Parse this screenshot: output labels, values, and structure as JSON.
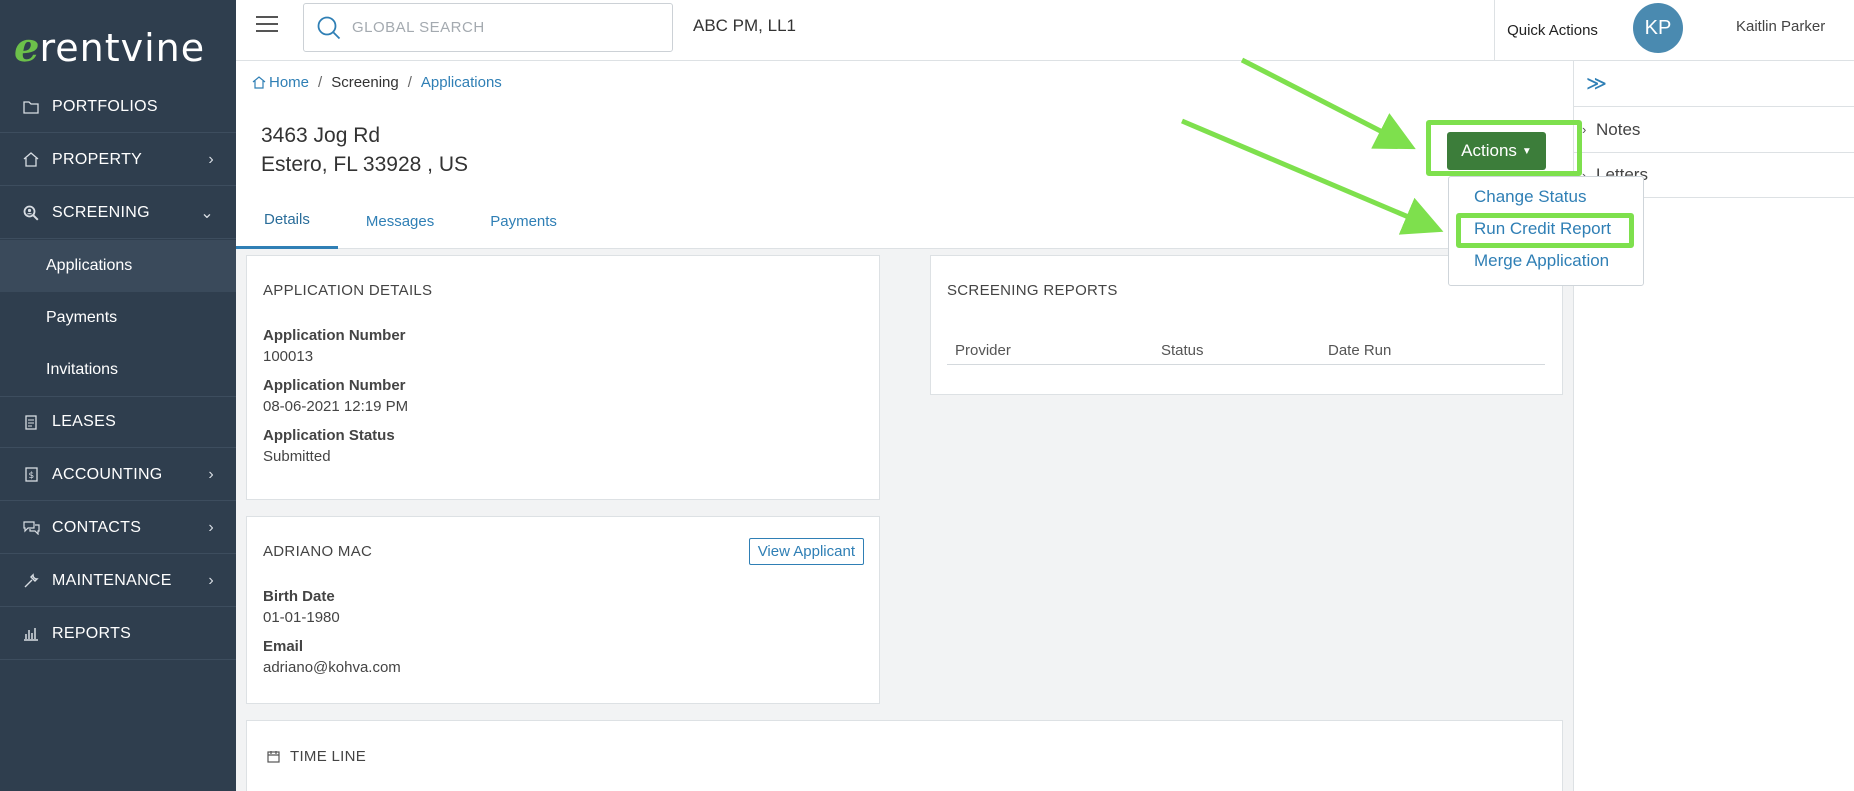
{
  "app": {
    "logo_mark": "ℯ",
    "logo_text": "rentvine"
  },
  "sidebar": {
    "items": [
      {
        "label": "PORTFOLIOS",
        "icon": "folder-icon",
        "chevron": ""
      },
      {
        "label": "PROPERTY",
        "icon": "home-icon",
        "chevron": "›"
      },
      {
        "label": "SCREENING",
        "icon": "search-user-icon",
        "chevron": "⌄"
      },
      {
        "label": "LEASES",
        "icon": "document-icon",
        "chevron": ""
      },
      {
        "label": "ACCOUNTING",
        "icon": "ledger-icon",
        "chevron": "›"
      },
      {
        "label": "CONTACTS",
        "icon": "chat-icon",
        "chevron": "›"
      },
      {
        "label": "MAINTENANCE",
        "icon": "wrench-icon",
        "chevron": "›"
      },
      {
        "label": "REPORTS",
        "icon": "bar-chart-icon",
        "chevron": ""
      }
    ],
    "subitems": [
      {
        "label": "Applications"
      },
      {
        "label": "Payments"
      },
      {
        "label": "Invitations"
      }
    ]
  },
  "topbar": {
    "search_placeholder": "GLOBAL SEARCH",
    "company": "ABC PM, LL1",
    "quick_actions": "Quick Actions",
    "avatar_initials": "KP",
    "username": "Kaitlin Parker"
  },
  "breadcrumb": {
    "home": "Home",
    "sep": "/",
    "screening": "Screening",
    "applications": "Applications"
  },
  "property": {
    "line1": "3463 Jog Rd",
    "line2": "Estero, FL 33928 , US"
  },
  "tabs": [
    "Details",
    "Messages",
    "Payments"
  ],
  "actions": {
    "label": "Actions",
    "menu": [
      "Change Status",
      "Run Credit Report",
      "Merge Application"
    ]
  },
  "right_panel": {
    "toggle": "≫",
    "rows": [
      "Notes",
      "Letters"
    ]
  },
  "application_details": {
    "title": "APPLICATION DETAILS",
    "fields": [
      {
        "label": "Application Number",
        "value": "100013"
      },
      {
        "label": "Application Number",
        "value": "08-06-2021 12:19 PM"
      },
      {
        "label": "Application Status",
        "value": "Submitted"
      }
    ]
  },
  "screening_reports": {
    "title": "SCREENING REPORTS",
    "columns": [
      "Provider",
      "Status",
      "Date Run"
    ]
  },
  "applicant": {
    "title": "ADRIANO MAC",
    "view_button": "View Applicant",
    "fields": [
      {
        "label": "Birth Date",
        "value": "01-01-1980"
      },
      {
        "label": "Email",
        "value": "adriano@kohva.com"
      }
    ]
  },
  "timeline": {
    "title": "TIME LINE"
  },
  "colors": {
    "sidebar": "#2f3e4e",
    "accent": "#2f7fb5",
    "action_green": "#3c7d3a",
    "highlight": "#7ee04d"
  }
}
